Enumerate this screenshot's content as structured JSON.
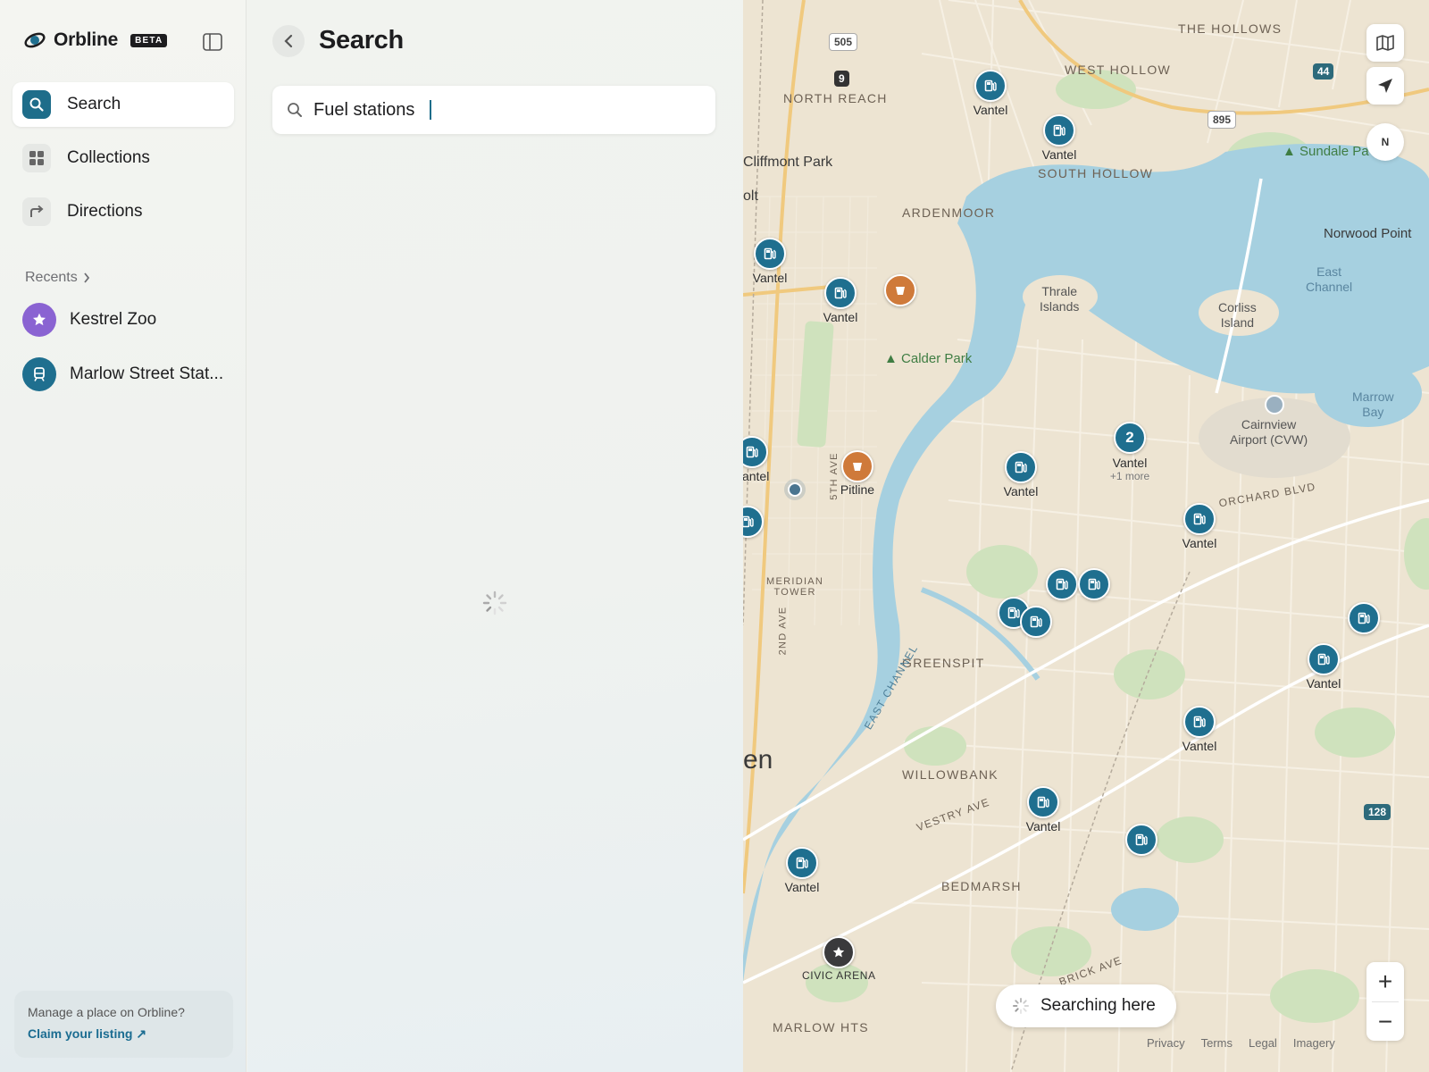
{
  "app": {
    "name": "Orbline",
    "badge": "BETA"
  },
  "nav": {
    "search": "Search",
    "collections": "Collections",
    "directions": "Directions"
  },
  "recents": {
    "heading": "Recents",
    "items": [
      {
        "label": "Kestrel Zoo",
        "icon": "star-icon",
        "color": "#8a63d2"
      },
      {
        "label": "Marlow Street Stat...",
        "icon": "train-icon",
        "color": "#1f6f8f"
      }
    ]
  },
  "claim": {
    "text": "Manage a place on Orbline?",
    "link": "Claim your listing ↗"
  },
  "panel": {
    "title": "Search"
  },
  "search": {
    "value": "Fuel stations"
  },
  "map": {
    "areas": [
      "THE HOLLOWS",
      "WEST HOLLOW",
      "NORTH REACH",
      "SOUTH HOLLOW",
      "ARDENMOOR",
      "GREENSPIT",
      "WILLOWBANK",
      "BEDMARSH",
      "MARLOW HTS",
      "ORCHARD BLVD",
      "VESTRY AVE",
      "BRICK AVE",
      "EAST CHANNEL",
      "2ND AVE",
      "5TH AVE",
      "MERIDIAN\nTOWER",
      "CIVIC ARENA"
    ],
    "places": [
      "Cliffmont Park",
      "olt",
      "Norwood Point",
      "en"
    ],
    "water": [
      "East\nChannel",
      "Marrow\nBay"
    ],
    "islands": [
      "Thrale\nIslands",
      "Corliss\nIsland",
      "Cairnview\nAirport (CVW)"
    ],
    "parks": [
      "Calder Park",
      "Sundale Pa"
    ],
    "highways": [
      "505",
      "9",
      "44",
      "895",
      "128",
      "128"
    ],
    "pin_label": "Vantel",
    "cluster": {
      "count": "2",
      "label": "Vantel",
      "sub": "+1 more"
    },
    "pitline": "Pitline",
    "compass": "N",
    "searching": "Searching here",
    "footer": [
      "Privacy",
      "Terms",
      "Legal",
      "Imagery"
    ]
  }
}
